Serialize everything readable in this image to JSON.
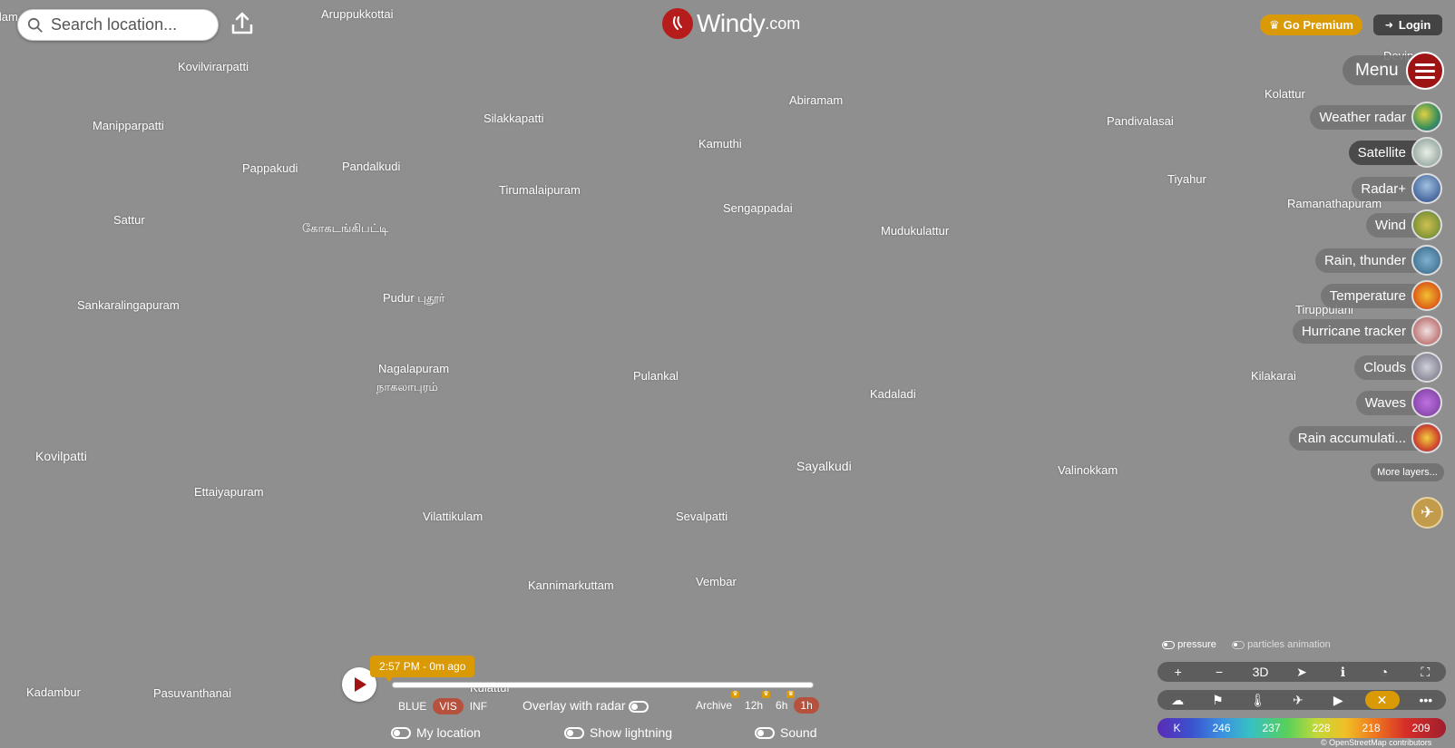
{
  "header": {
    "search_placeholder": "Search location...",
    "brand": "Windy",
    "brand_tld": ".com",
    "premium_label": "Go Premium",
    "login_label": "Login",
    "menu_label": "Menu"
  },
  "places": [
    {
      "name": "Aruppukkottai"
    },
    {
      "name": "Kovilvirarpatti"
    },
    {
      "name": "Manipparpatti"
    },
    {
      "name": "Silakkapatti"
    },
    {
      "name": "Abiramam"
    },
    {
      "name": "Kamuthi"
    },
    {
      "name": "Pappakudi"
    },
    {
      "name": "Pandalkudi"
    },
    {
      "name": "Tirumalaipuram"
    },
    {
      "name": "Sattur"
    },
    {
      "name": "கோகடங்கிபட்டி"
    },
    {
      "name": "Sengappadai"
    },
    {
      "name": "Mudukulattur"
    },
    {
      "name": "Sankaralingapuram"
    },
    {
      "name": "Pudur புதூர்"
    },
    {
      "name": "Nagalapuram"
    },
    {
      "name": "நாகலாபுரம்"
    },
    {
      "name": "Pulankal"
    },
    {
      "name": "Kadaladi"
    },
    {
      "name": "Kovilpatti"
    },
    {
      "name": "Sayalkudi"
    },
    {
      "name": "Valinokkam"
    },
    {
      "name": "Ettaiyapuram"
    },
    {
      "name": "Vilattikulam"
    },
    {
      "name": "Sevalpatti"
    },
    {
      "name": "Kannimarkuttam"
    },
    {
      "name": "Vembar"
    },
    {
      "name": "Kadambur"
    },
    {
      "name": "Pasuvanthanai"
    },
    {
      "name": "Kulattur"
    },
    {
      "name": "Kolattur"
    },
    {
      "name": "Pandivalasai"
    },
    {
      "name": "Tiyahur"
    },
    {
      "name": "Ramanathapuram"
    },
    {
      "name": "Tiruppulani"
    },
    {
      "name": "Kilakarai"
    },
    {
      "name": "Devip..."
    },
    {
      "name": "llam"
    }
  ],
  "layers": [
    {
      "label": "Weather radar",
      "color": "#3a8f5a"
    },
    {
      "label": "Satellite",
      "color": "#9fb0a8",
      "active": true
    },
    {
      "label": "Radar+",
      "color": "#4a6aa0"
    },
    {
      "label": "Wind",
      "color": "#8a9a3a"
    },
    {
      "label": "Rain, thunder",
      "color": "#4a7a9a"
    },
    {
      "label": "Temperature",
      "color": "#e06a1a"
    },
    {
      "label": "Hurricane tracker",
      "color": "#c07a7a"
    },
    {
      "label": "Clouds",
      "color": "#8a8a9a"
    },
    {
      "label": "Waves",
      "color": "#8a4ab0"
    },
    {
      "label": "Rain accumulati...",
      "color": "#d04a2a"
    }
  ],
  "more_layers_label": "More layers...",
  "toggles": {
    "pressure": "pressure",
    "particles": "particles animation"
  },
  "controls_row1": [
    "+",
    "−",
    "3D",
    "➤",
    "ℹ",
    "◔",
    "⛶"
  ],
  "controls_row2": [
    "☁",
    "⚑",
    "🌡",
    "✈",
    "▶",
    "✕",
    "•••"
  ],
  "legend": {
    "unit": "K",
    "values": [
      "246",
      "237",
      "228",
      "218",
      "209"
    ]
  },
  "attribution": "© OpenStreetMap contributors",
  "player": {
    "time_label": "2:57 PM - 0m ago",
    "bands": [
      "BLUE",
      "VIS",
      "INF"
    ],
    "overlay_label": "Overlay with radar",
    "archive_label": "Archive",
    "intervals": [
      "12h",
      "6h",
      "1h"
    ],
    "my_location": "My location",
    "show_lightning": "Show lightning",
    "sound": "Sound"
  }
}
